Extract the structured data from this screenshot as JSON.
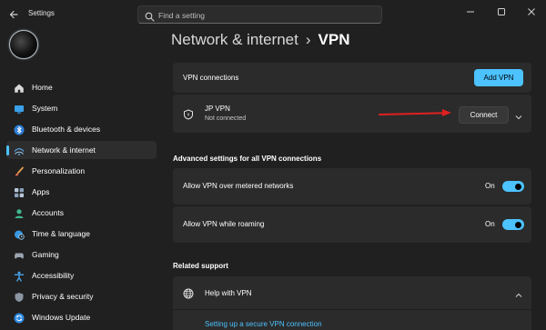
{
  "window": {
    "title": "Settings",
    "search_placeholder": "Find a setting"
  },
  "sidebar": {
    "items": [
      {
        "label": "Home",
        "icon": "home-icon",
        "selected": false
      },
      {
        "label": "System",
        "icon": "monitor-icon",
        "selected": false
      },
      {
        "label": "Bluetooth & devices",
        "icon": "bluetooth-icon",
        "selected": false
      },
      {
        "label": "Network & internet",
        "icon": "network-icon",
        "selected": true
      },
      {
        "label": "Personalization",
        "icon": "brush-icon",
        "selected": false
      },
      {
        "label": "Apps",
        "icon": "apps-icon",
        "selected": false
      },
      {
        "label": "Accounts",
        "icon": "person-icon",
        "selected": false
      },
      {
        "label": "Time & language",
        "icon": "globe-clock-icon",
        "selected": false
      },
      {
        "label": "Gaming",
        "icon": "gamepad-icon",
        "selected": false
      },
      {
        "label": "Accessibility",
        "icon": "accessibility-icon",
        "selected": false
      },
      {
        "label": "Privacy & security",
        "icon": "shield-icon",
        "selected": false
      },
      {
        "label": "Windows Update",
        "icon": "update-icon",
        "selected": false
      }
    ]
  },
  "breadcrumb": {
    "parent": "Network & internet",
    "separator": "›",
    "current": "VPN"
  },
  "vpn_connections": {
    "label": "VPN connections",
    "add_button": "Add VPN"
  },
  "vpn_item": {
    "name": "JP VPN",
    "status": "Not connected",
    "connect_button": "Connect"
  },
  "advanced": {
    "title": "Advanced settings for all VPN connections",
    "metered": {
      "label": "Allow VPN over metered networks",
      "state": "On",
      "on": true
    },
    "roaming": {
      "label": "Allow VPN while roaming",
      "state": "On",
      "on": true
    }
  },
  "support": {
    "title": "Related support",
    "help_label": "Help with VPN",
    "link": "Setting up a secure VPN connection"
  },
  "colors": {
    "accent": "#4cc2ff",
    "background": "#202020",
    "card": "#2b2b2b",
    "arrow": "#e02020"
  }
}
